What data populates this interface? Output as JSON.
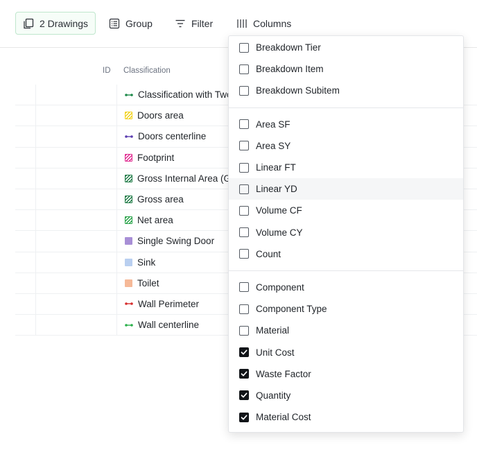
{
  "toolbar": {
    "drawings_label": "2 Drawings",
    "group_label": "Group",
    "filter_label": "Filter",
    "columns_label": "Columns"
  },
  "table": {
    "headers": {
      "id": "ID",
      "classification": "Classification"
    },
    "rows": [
      {
        "label": "Classification with Two",
        "icon": "line",
        "color": "#1e8a4a"
      },
      {
        "label": "Doors area",
        "icon": "hatch",
        "color": "#f2d21b"
      },
      {
        "label": "Doors centerline",
        "icon": "line",
        "color": "#5b3db0"
      },
      {
        "label": "Footprint",
        "icon": "hatch",
        "color": "#e0288f"
      },
      {
        "label": "Gross Internal Area (G",
        "icon": "hatch",
        "color": "#1e7a45"
      },
      {
        "label": "Gross area",
        "icon": "hatch",
        "color": "#1e7a45"
      },
      {
        "label": "Net area",
        "icon": "hatch",
        "color": "#2aa34a"
      },
      {
        "label": "Single Swing Door",
        "icon": "solid",
        "color": "#a88fd6"
      },
      {
        "label": "Sink",
        "icon": "solid",
        "color": "#b9cff0"
      },
      {
        "label": "Toilet",
        "icon": "solid",
        "color": "#f6b998"
      },
      {
        "label": "Wall Perimeter",
        "icon": "line",
        "color": "#d62d2d"
      },
      {
        "label": "Wall centerline",
        "icon": "line",
        "color": "#2ab04a"
      }
    ]
  },
  "columns_menu": {
    "groups": [
      [
        {
          "label": "Breakdown Tier",
          "checked": false
        },
        {
          "label": "Breakdown Item",
          "checked": false
        },
        {
          "label": "Breakdown Subitem",
          "checked": false
        }
      ],
      [
        {
          "label": "Area SF",
          "checked": false
        },
        {
          "label": "Area SY",
          "checked": false
        },
        {
          "label": "Linear FT",
          "checked": false
        },
        {
          "label": "Linear YD",
          "checked": false,
          "hover": true
        },
        {
          "label": "Volume CF",
          "checked": false
        },
        {
          "label": "Volume CY",
          "checked": false
        },
        {
          "label": "Count",
          "checked": false
        }
      ],
      [
        {
          "label": "Component",
          "checked": false
        },
        {
          "label": "Component Type",
          "checked": false
        },
        {
          "label": "Material",
          "checked": false
        },
        {
          "label": "Unit Cost",
          "checked": true
        },
        {
          "label": "Waste Factor",
          "checked": true
        },
        {
          "label": "Quantity",
          "checked": true
        },
        {
          "label": "Material Cost",
          "checked": true
        }
      ]
    ]
  }
}
